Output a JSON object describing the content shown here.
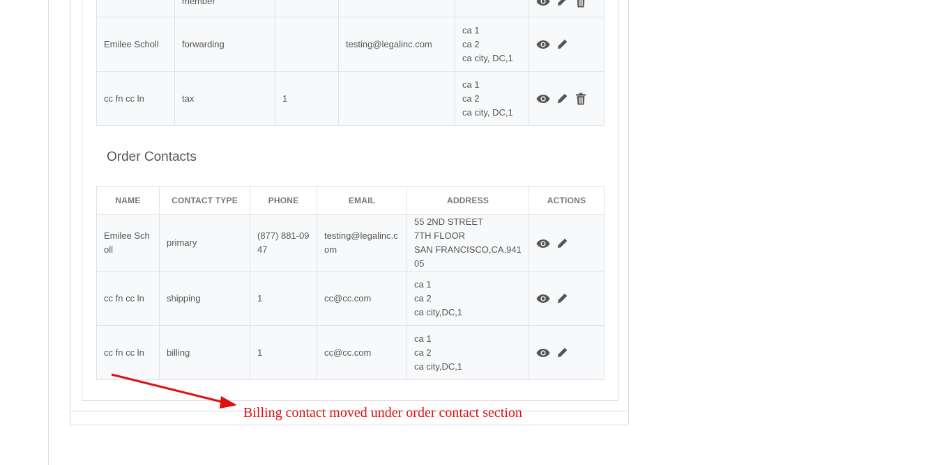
{
  "top_table": {
    "rows": [
      {
        "name": "",
        "type": "member",
        "phone": "",
        "email": "",
        "address": [],
        "actions": [
          "view-icon",
          "edit-icon",
          "delete-icon"
        ]
      },
      {
        "name": "Emilee Scholl",
        "type": "forwarding",
        "phone": "",
        "email": "testing@legalinc.com",
        "address": [
          "ca 1",
          "ca 2",
          "ca city, DC,1"
        ],
        "actions": [
          "view-icon",
          "edit-icon"
        ]
      },
      {
        "name": "cc fn cc ln",
        "type": "tax",
        "phone": "1",
        "email": "",
        "address": [
          "ca 1",
          "ca 2",
          "ca city, DC,1"
        ],
        "actions": [
          "view-icon",
          "edit-icon",
          "delete-icon"
        ]
      }
    ]
  },
  "order_contacts": {
    "title": "Order Contacts",
    "headers": [
      "NAME",
      "CONTACT TYPE",
      "PHONE",
      "EMAIL",
      "ADDRESS",
      "ACTIONS"
    ],
    "rows": [
      {
        "name": "Emilee Scholl",
        "type": "primary",
        "phone": "(877) 881-0947",
        "email": "testing@legalinc.com",
        "address": [
          "55 2ND STREET",
          "7TH FLOOR",
          "SAN FRANCISCO,CA,94105"
        ],
        "actions": [
          "view-icon",
          "edit-icon"
        ]
      },
      {
        "name": "cc fn cc ln",
        "type": "shipping",
        "phone": "1",
        "email": "cc@cc.com",
        "address": [
          "ca 1",
          "ca 2",
          "ca city,DC,1"
        ],
        "actions": [
          "view-icon",
          "edit-icon"
        ]
      },
      {
        "name": "cc fn cc ln",
        "type": "billing",
        "phone": "1",
        "email": "cc@cc.com",
        "address": [
          "ca 1",
          "ca 2",
          "ca city,DC,1"
        ],
        "actions": [
          "view-icon",
          "edit-icon"
        ]
      }
    ]
  },
  "annotation": {
    "text": "Billing contact moved under order contact section",
    "color": "#e01010"
  },
  "colors": {
    "row_bg": "#f8f9fa",
    "border": "#dee2e6",
    "icon": "#555555"
  }
}
